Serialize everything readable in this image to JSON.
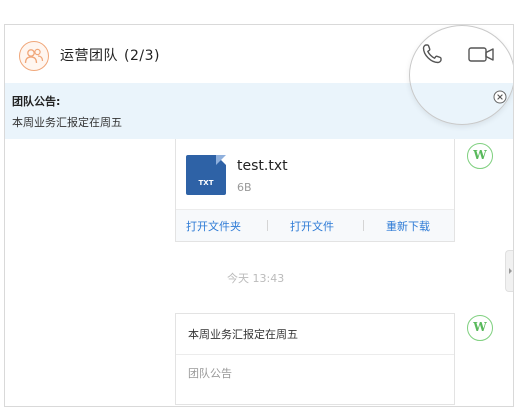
{
  "header": {
    "team_name": "运营团队",
    "member_count": "(2/3)",
    "avatar_icon": "group-icon",
    "call_icon": "phone-icon",
    "video_icon": "video-camera-icon"
  },
  "notice": {
    "title": "团队公告:",
    "text": "本周业务汇报定在周五",
    "close_icon": "close-circle-icon"
  },
  "file_message": {
    "file_name": "test.txt",
    "file_size": "6B",
    "file_type_badge": "TXT",
    "actions": [
      "打开文件夹",
      "打开文件",
      "重新下载"
    ]
  },
  "timestamp": "今天 13:43",
  "announcement_message": {
    "text": "本周业务汇报定在周五",
    "label": "团队公告"
  },
  "avatars": {
    "letter": "W",
    "color": "#59b95c"
  },
  "colors": {
    "accent": "#2e7bd6",
    "notice_bg": "#eaf4fb",
    "file_icon_bg": "#2e62a6",
    "avatar_orange": "#f0a77a"
  }
}
